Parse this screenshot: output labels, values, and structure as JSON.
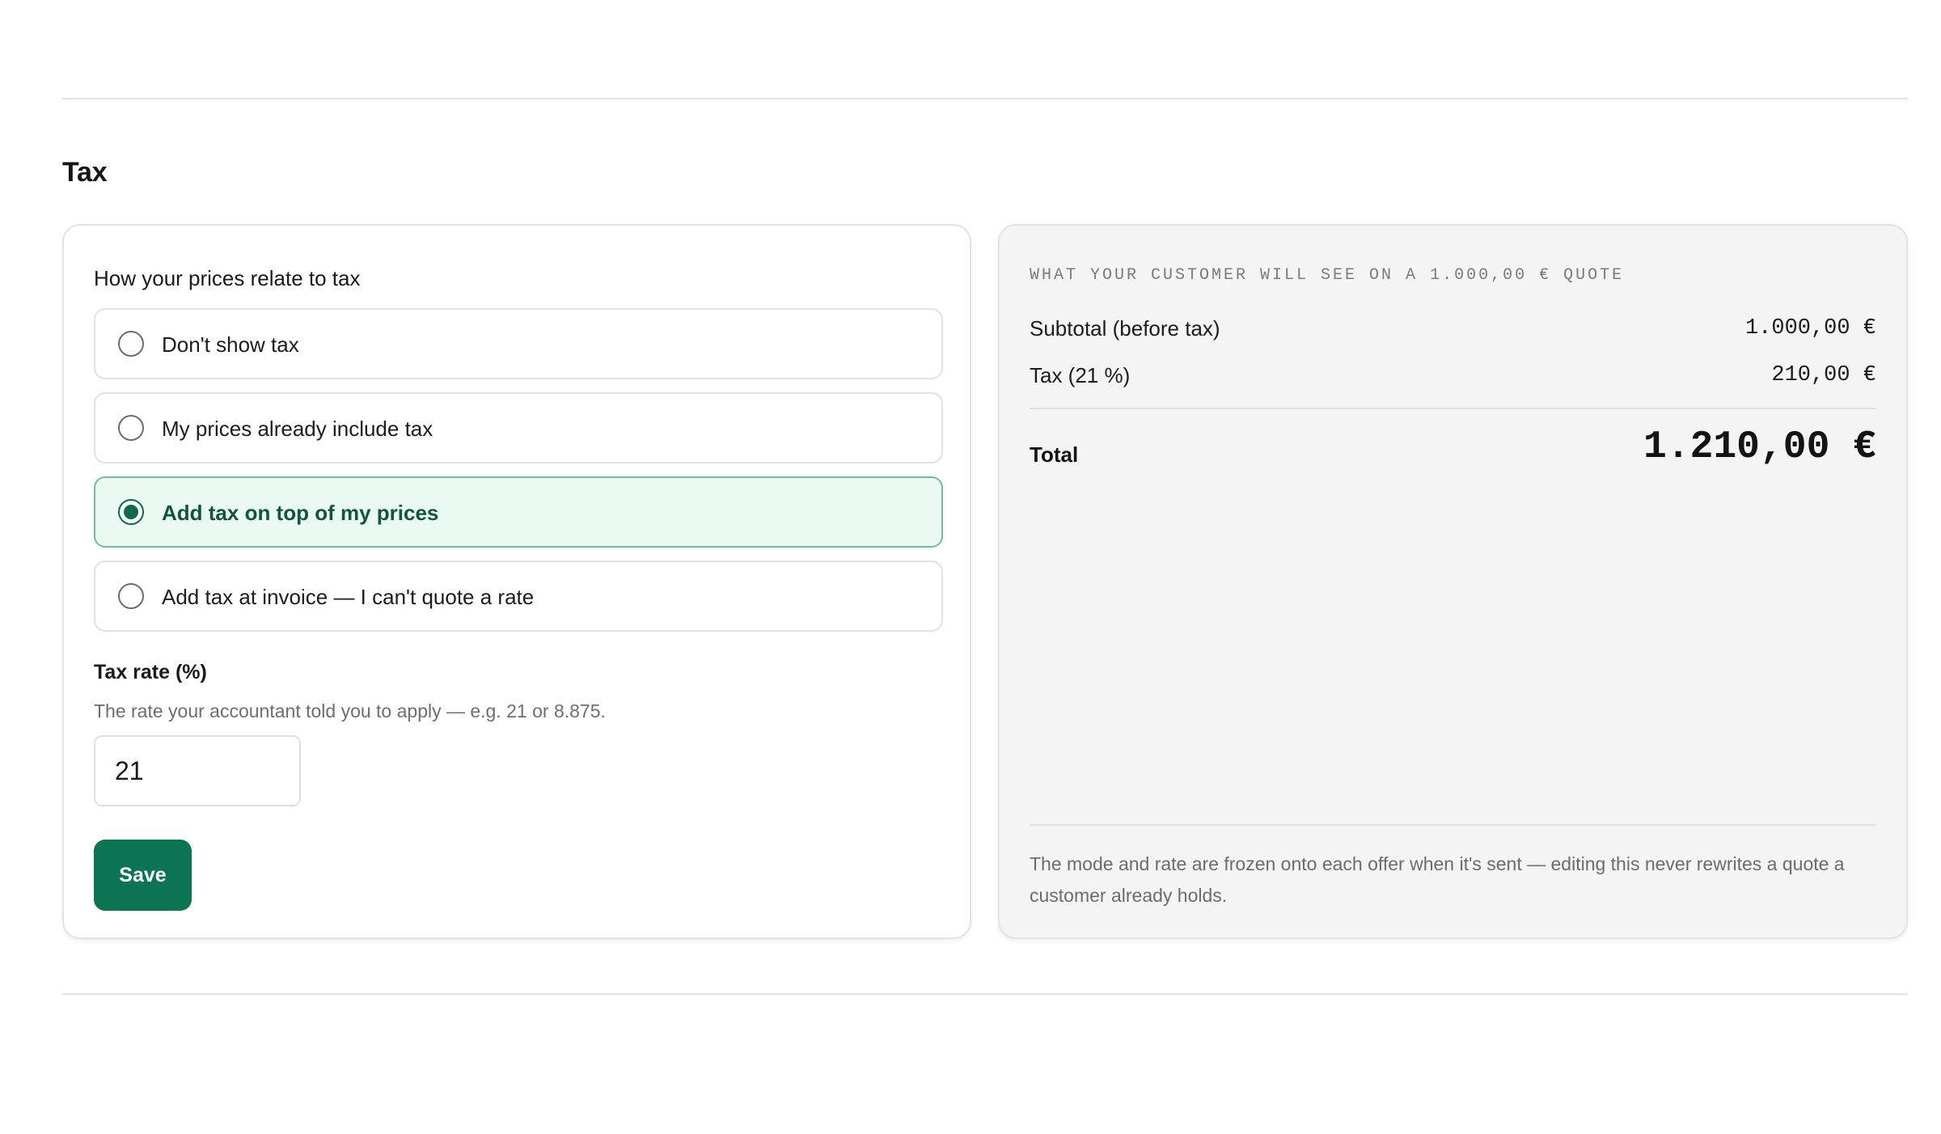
{
  "section": {
    "title": "Tax"
  },
  "settings": {
    "group_label": "How your prices relate to tax",
    "options": [
      {
        "label": "Don't show tax",
        "selected": false
      },
      {
        "label": "My prices already include tax",
        "selected": false
      },
      {
        "label": "Add tax on top of my prices",
        "selected": true
      },
      {
        "label": "Add tax at invoice — I can't quote a rate",
        "selected": false
      }
    ],
    "rate": {
      "label": "Tax rate (%)",
      "help": "The rate your accountant told you to apply — e.g. 21 or 8.875.",
      "value": "21"
    },
    "save_label": "Save"
  },
  "preview": {
    "heading": "WHAT YOUR CUSTOMER WILL SEE ON A 1.000,00 € QUOTE",
    "subtotal_label": "Subtotal (before tax)",
    "subtotal_value": "1.000,00 €",
    "tax_label": "Tax (21 %)",
    "tax_value": "210,00 €",
    "total_label": "Total",
    "total_value": "1.210,00 €",
    "footnote": "The mode and rate are frozen onto each offer when it's sent — editing this never rewrites a quote a customer already holds."
  },
  "colors": {
    "accent": "#0b7553",
    "selected_bg": "#eafaf1",
    "preview_bg": "#f4f4f4"
  }
}
